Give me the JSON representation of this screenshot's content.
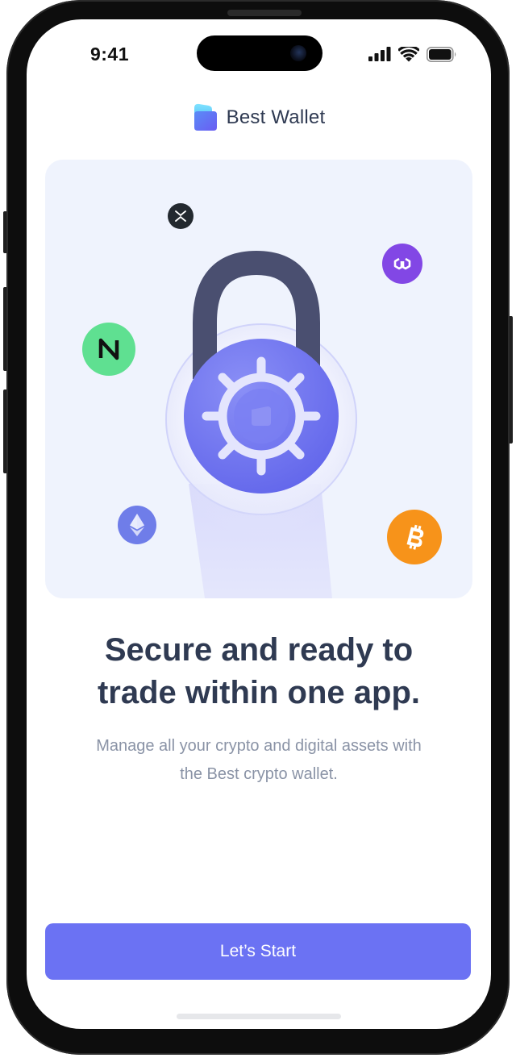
{
  "status_bar": {
    "time": "9:41"
  },
  "brand": {
    "name": "Best Wallet",
    "accent_color": "#6b72f3"
  },
  "hero": {
    "icons": [
      "xrp-coin-icon",
      "polygon-coin-icon",
      "near-coin-icon",
      "padlock-icon",
      "ethereum-coin-icon",
      "bitcoin-coin-icon"
    ]
  },
  "content": {
    "title_line1": "Secure and ready to",
    "title_line2": "trade within one app.",
    "subtitle_line1": "Manage all your crypto and digital assets with",
    "subtitle_line2": "the Best crypto wallet."
  },
  "cta": {
    "label": "Let’s Start"
  }
}
